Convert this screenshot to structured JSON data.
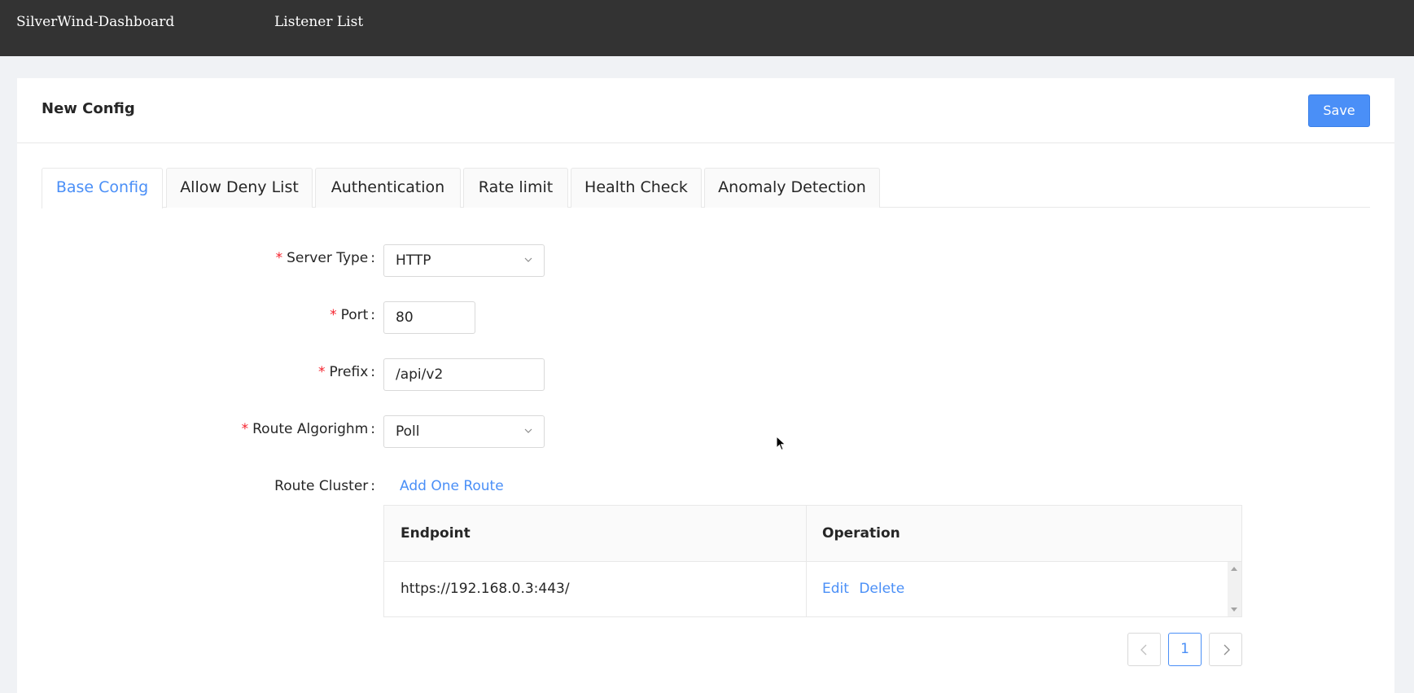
{
  "header": {
    "brand": "SilverWind-Dashboard",
    "nav_listener": "Listener List"
  },
  "page": {
    "title": "New Config",
    "save_label": "Save"
  },
  "tabs": [
    {
      "label": "Base Config",
      "active": true
    },
    {
      "label": "Allow Deny List",
      "active": false
    },
    {
      "label": "Authentication",
      "active": false
    },
    {
      "label": "Rate limit",
      "active": false
    },
    {
      "label": "Health Check",
      "active": false
    },
    {
      "label": "Anomaly Detection",
      "active": false
    }
  ],
  "form": {
    "server_type": {
      "label": "Server Type",
      "value": "HTTP"
    },
    "port": {
      "label": "Port",
      "value": "80"
    },
    "prefix": {
      "label": "Prefix",
      "value": "/api/v2"
    },
    "route_algorithm": {
      "label": "Route Algorighm",
      "value": "Poll"
    },
    "route_cluster": {
      "label": "Route Cluster",
      "add_label": "Add One Route"
    }
  },
  "route_table": {
    "columns": [
      "Endpoint",
      "Operation"
    ],
    "rows": [
      {
        "endpoint": "https://192.168.0.3:443/",
        "edit": "Edit",
        "delete": "Delete"
      }
    ]
  },
  "pagination": {
    "current": "1"
  },
  "colors": {
    "topbar": "#333333",
    "accent": "#4a8ff7",
    "required": "#f5222d",
    "background": "#f0f2f5"
  },
  "icons": [
    "chevron-down-icon",
    "chevron-left-icon",
    "chevron-right-icon",
    "mouse-cursor-icon"
  ]
}
